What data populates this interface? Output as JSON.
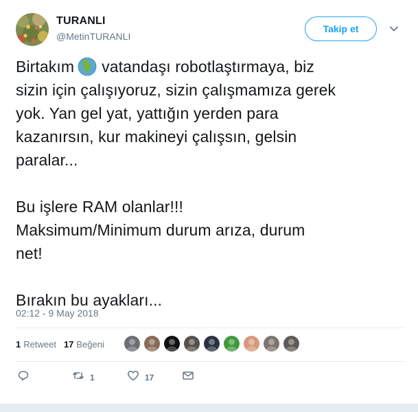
{
  "user": {
    "name": "TURANLI",
    "handle": "@MetinTURANLI"
  },
  "follow_label": "Takip et",
  "tweet": {
    "paragraph1": [
      {
        "before": "Birtakım",
        "after": "vatandaşı robotlaştırmaya, biz"
      },
      "sizin için çalışıyoruz, sizin çalışmamıza gerek",
      "yok. Yan gel yat, yattığın yerden para",
      "kazanırsın, kur makineyi çalışsın, gelsin",
      "paralar..."
    ],
    "paragraph2": [
      "Bu işlere RAM olanlar!!!",
      "Maksimum/Minimum durum arıza, durum",
      "net!"
    ],
    "paragraph3": [
      "Bırakın bu ayakları..."
    ],
    "emoji": "globe-africa-emoji"
  },
  "timestamp": "02:12 - 9 May 2018",
  "stats": {
    "retweets_count": "1",
    "retweets_label": "Retweet",
    "likes_count": "17",
    "likes_label": "Beğeni"
  },
  "likers": [
    {
      "color": "#6b6e74"
    },
    {
      "color": "#8a6a58"
    },
    {
      "color": "#111111"
    },
    {
      "color": "#55504d"
    },
    {
      "color": "#2a3142"
    },
    {
      "color": "#3f9a3b"
    },
    {
      "color": "#d79a7a"
    },
    {
      "color": "#7d7470"
    },
    {
      "color": "#5e5a57"
    }
  ],
  "actions": {
    "reply_icon": "reply-icon",
    "retweet_icon": "retweet-icon",
    "retweet_count": "1",
    "like_icon": "heart-icon",
    "like_count": "17",
    "dm_icon": "envelope-icon"
  },
  "colors": {
    "accent": "#1da1f2",
    "secondary_text": "#657786",
    "divider": "#e6ecf0"
  }
}
